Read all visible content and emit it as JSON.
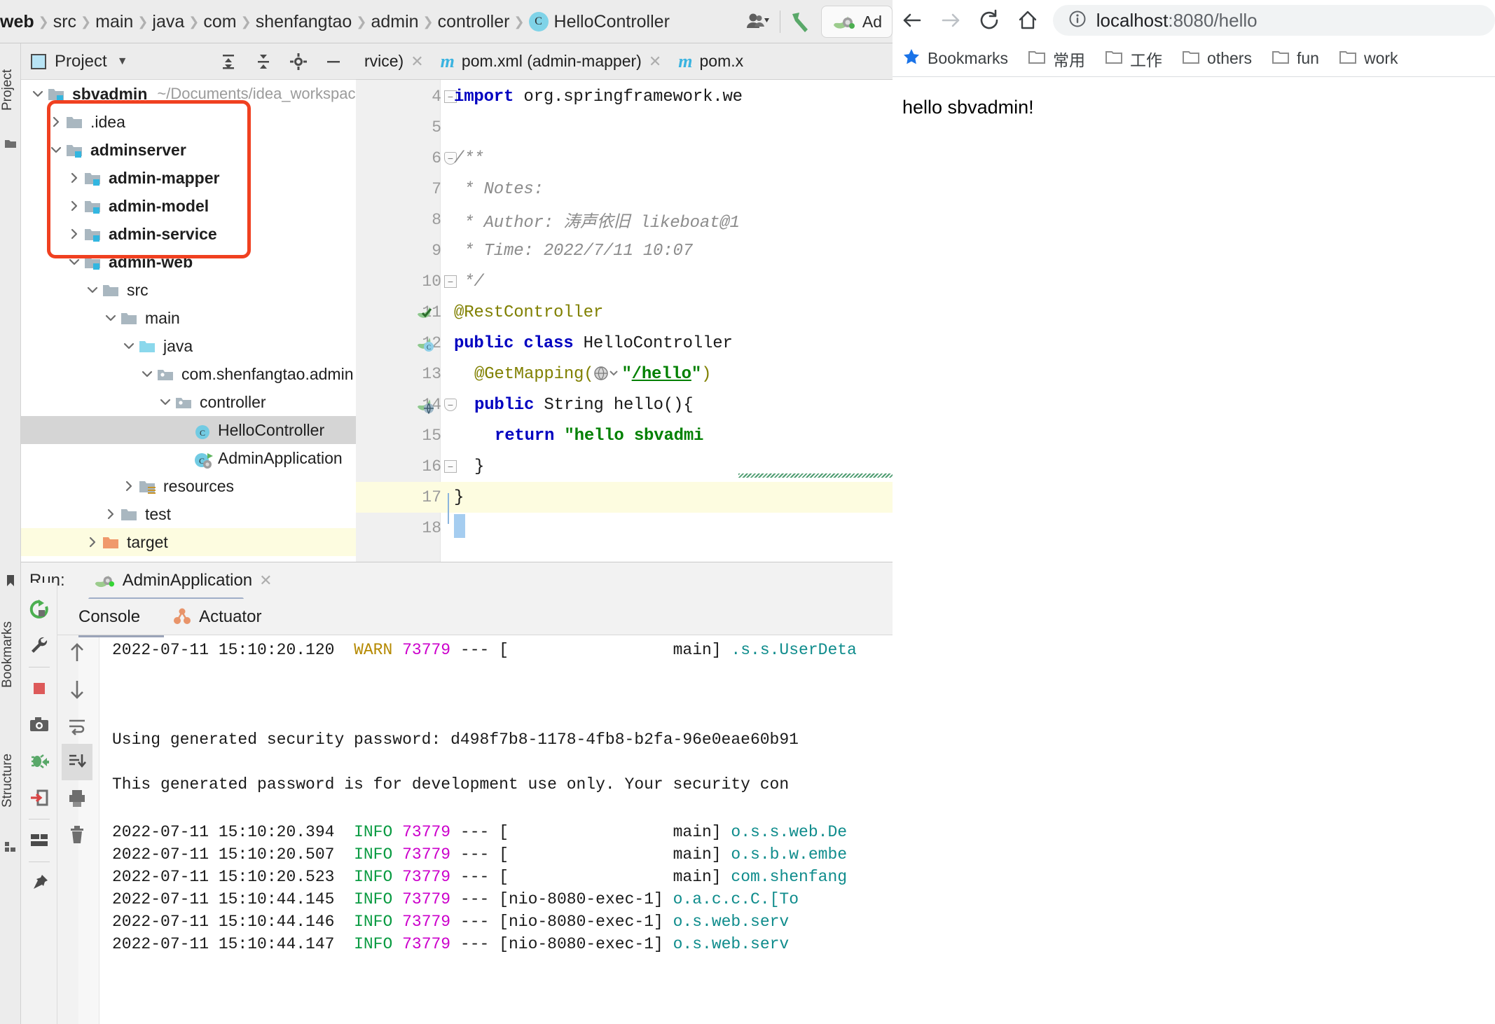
{
  "ide": {
    "breadcrumb": [
      {
        "label": "web",
        "type": "module"
      },
      {
        "label": "src",
        "type": "dir"
      },
      {
        "label": "main",
        "type": "dir"
      },
      {
        "label": "java",
        "type": "dir"
      },
      {
        "label": "com",
        "type": "dir"
      },
      {
        "label": "shenfangtao",
        "type": "dir"
      },
      {
        "label": "admin",
        "type": "dir"
      },
      {
        "label": "controller",
        "type": "dir"
      },
      {
        "label": "HelloController",
        "type": "class"
      }
    ],
    "class_badge": "C",
    "toolbar": {
      "profile_icon": "user-dropdown-icon",
      "build_icon": "hammer-icon",
      "run_config_label": "Ad"
    },
    "project_panel": {
      "title": "Project",
      "icon": "project-window-icon",
      "actions": [
        "expand-all-icon",
        "collapse-all-icon",
        "settings-gear-icon",
        "hide-minus-icon"
      ]
    },
    "tool_stripes": {
      "left_top": "Project",
      "left_bottom_1": "Bookmarks",
      "left_bottom_2": "Structure"
    },
    "tree": [
      {
        "label": "sbvadmin",
        "path": "~/Documents/idea_workspace/sbv",
        "indent": 0,
        "state": "open",
        "icon": "module-folder",
        "bold": true,
        "selected": false
      },
      {
        "label": ".idea",
        "path": "",
        "indent": 1,
        "state": "closed",
        "icon": "folder",
        "bold": false,
        "selected": false
      },
      {
        "label": "adminserver",
        "path": "",
        "indent": 1,
        "state": "open",
        "icon": "module-folder",
        "bold": true,
        "selected": false
      },
      {
        "label": "admin-mapper",
        "path": "",
        "indent": 2,
        "state": "closed",
        "icon": "module-folder",
        "bold": true,
        "selected": false
      },
      {
        "label": "admin-model",
        "path": "",
        "indent": 2,
        "state": "closed",
        "icon": "module-folder",
        "bold": true,
        "selected": false
      },
      {
        "label": "admin-service",
        "path": "",
        "indent": 2,
        "state": "closed",
        "icon": "module-folder",
        "bold": true,
        "selected": false
      },
      {
        "label": "admin-web",
        "path": "",
        "indent": 2,
        "state": "open",
        "icon": "module-folder",
        "bold": true,
        "selected": false
      },
      {
        "label": "src",
        "path": "",
        "indent": 3,
        "state": "open",
        "icon": "folder",
        "bold": false,
        "selected": false
      },
      {
        "label": "main",
        "path": "",
        "indent": 4,
        "state": "open",
        "icon": "folder",
        "bold": false,
        "selected": false
      },
      {
        "label": "java",
        "path": "",
        "indent": 5,
        "state": "open",
        "icon": "source-folder",
        "bold": false,
        "selected": false
      },
      {
        "label": "com.shenfangtao.admin",
        "path": "",
        "indent": 6,
        "state": "open",
        "icon": "package",
        "bold": false,
        "selected": false
      },
      {
        "label": "controller",
        "path": "",
        "indent": 7,
        "state": "open",
        "icon": "package",
        "bold": false,
        "selected": false
      },
      {
        "label": "HelloController",
        "path": "",
        "indent": 8,
        "state": "leaf",
        "icon": "java-class",
        "bold": false,
        "selected": true
      },
      {
        "label": "AdminApplication",
        "path": "",
        "indent": 8,
        "state": "leaf",
        "icon": "spring-class",
        "bold": false,
        "selected": false
      },
      {
        "label": "resources",
        "path": "",
        "indent": 5,
        "state": "closed",
        "icon": "resource-folder",
        "bold": false,
        "selected": false
      },
      {
        "label": "test",
        "path": "",
        "indent": 4,
        "state": "closed",
        "icon": "folder",
        "bold": false,
        "selected": false
      },
      {
        "label": "target",
        "path": "",
        "indent": 3,
        "state": "closed",
        "icon": "target-folder",
        "bold": false,
        "selected": false,
        "highlight": true
      }
    ],
    "annotation": {
      "shape": "rounded-rect",
      "color": "#f04020"
    },
    "editor_tabs": [
      {
        "label": "rvice)",
        "icon": "maven-m",
        "closable": true,
        "show_icon": false
      },
      {
        "label": "pom.xml (admin-mapper)",
        "icon": "maven-m",
        "closable": true,
        "show_icon": true
      },
      {
        "label": "pom.x",
        "icon": "maven-m",
        "closable": false,
        "show_icon": true
      }
    ],
    "code": [
      {
        "n": "4",
        "indent": 0,
        "tokens": [
          {
            "t": "import ",
            "c": "kw"
          },
          {
            "t": "org.springframework.we",
            "c": "plain"
          }
        ],
        "fold": "minus",
        "gutter": ""
      },
      {
        "n": "5",
        "indent": 0,
        "tokens": [],
        "fold": "",
        "gutter": ""
      },
      {
        "n": "6",
        "indent": 0,
        "tokens": [
          {
            "t": "/**",
            "c": "cmt"
          }
        ],
        "fold": "minus-round",
        "gutter": ""
      },
      {
        "n": "7",
        "indent": 0,
        "tokens": [
          {
            "t": " * Notes:",
            "c": "cmt"
          }
        ],
        "fold": "",
        "gutter": ""
      },
      {
        "n": "8",
        "indent": 0,
        "tokens": [
          {
            "t": " * Author: 涛声依旧 likeboat@1",
            "c": "cmt"
          }
        ],
        "fold": "",
        "gutter": ""
      },
      {
        "n": "9",
        "indent": 0,
        "tokens": [
          {
            "t": " * Time: 2022/7/11 10:07",
            "c": "cmt"
          }
        ],
        "fold": "",
        "gutter": ""
      },
      {
        "n": "10",
        "indent": 0,
        "tokens": [
          {
            "t": " */",
            "c": "cmt"
          }
        ],
        "fold": "minus",
        "gutter": ""
      },
      {
        "n": "11",
        "indent": 0,
        "tokens": [
          {
            "t": "@RestController",
            "c": "ann"
          }
        ],
        "fold": "",
        "gutter": "spring-bean-check-icon"
      },
      {
        "n": "12",
        "indent": 0,
        "tokens": [
          {
            "t": "public class ",
            "c": "kw"
          },
          {
            "t": "HelloController ",
            "c": "plain"
          }
        ],
        "fold": "",
        "gutter": "spring-bean-icon"
      },
      {
        "n": "13",
        "indent": 1,
        "tokens": [
          {
            "t": "@GetMapping(",
            "c": "ann"
          },
          {
            "t": "GLOBE",
            "c": "globe"
          },
          {
            "t": "\"",
            "c": "str"
          },
          {
            "t": "/hello",
            "c": "ulink"
          },
          {
            "t": "\"",
            "c": "str"
          },
          {
            "t": ")",
            "c": "ann"
          }
        ],
        "fold": "",
        "gutter": ""
      },
      {
        "n": "14",
        "indent": 1,
        "tokens": [
          {
            "t": "public ",
            "c": "kw"
          },
          {
            "t": "String hello(){",
            "c": "plain"
          }
        ],
        "fold": "minus-round",
        "gutter": "spring-mapping-icon"
      },
      {
        "n": "15",
        "indent": 2,
        "tokens": [
          {
            "t": "return ",
            "c": "kw"
          },
          {
            "t": "\"hello sbvadmi",
            "c": "str"
          }
        ],
        "fold": "",
        "gutter": ""
      },
      {
        "n": "16",
        "indent": 1,
        "tokens": [
          {
            "t": "}",
            "c": "plain"
          }
        ],
        "fold": "minus",
        "gutter": ""
      },
      {
        "n": "17",
        "indent": 0,
        "tokens": [
          {
            "t": "}",
            "c": "plain"
          }
        ],
        "fold": "",
        "gutter": "",
        "current": true
      },
      {
        "n": "18",
        "indent": 0,
        "tokens": [],
        "fold": "",
        "gutter": ""
      }
    ],
    "run_window": {
      "run_label": "Run:",
      "config_name": "AdminApplication",
      "config_icon": "spring-boot-icon",
      "close_icon": "close-icon",
      "tabs": [
        {
          "label": "Console",
          "icon": ""
        },
        {
          "label": "Actuator",
          "icon": "actuator-icon"
        }
      ],
      "side_tools": [
        "rerun-icon",
        "wrench-icon",
        "stop-icon",
        "camera-icon",
        "thread-dump-icon",
        "exit-icon",
        "layout-icon",
        "pin-icon"
      ],
      "console_tools": [
        "scroll-up-icon",
        "scroll-down-icon",
        "soft-wrap-icon",
        "scroll-to-end-icon",
        "print-icon",
        "trash-icon"
      ],
      "log_lines": [
        {
          "time": "2022-07-11 15:10:20.120",
          "level": "WARN",
          "pid": "73779",
          "dashes": "---",
          "thread": "[                 main]",
          "logger": ".s.s.UserDeta",
          "message": ""
        },
        {
          "time": "",
          "level": "",
          "pid": "",
          "dashes": "",
          "thread": "",
          "logger": "",
          "message": "Using generated security password: d498f7b8-1178-4fb8-b2fa-96e0eae60b91"
        },
        {
          "time": "",
          "level": "",
          "pid": "",
          "dashes": "",
          "thread": "",
          "logger": "",
          "message": "This generated password is for development use only. Your security con"
        },
        {
          "time": "2022-07-11 15:10:20.394",
          "level": "INFO",
          "pid": "73779",
          "dashes": "---",
          "thread": "[                 main]",
          "logger": "o.s.s.web.De",
          "message": ""
        },
        {
          "time": "2022-07-11 15:10:20.507",
          "level": "INFO",
          "pid": "73779",
          "dashes": "---",
          "thread": "[                 main]",
          "logger": "o.s.b.w.embe",
          "message": ""
        },
        {
          "time": "2022-07-11 15:10:20.523",
          "level": "INFO",
          "pid": "73779",
          "dashes": "---",
          "thread": "[                 main]",
          "logger": "com.shenfang",
          "message": ""
        },
        {
          "time": "2022-07-11 15:10:44.145",
          "level": "INFO",
          "pid": "73779",
          "dashes": "---",
          "thread": "[nio-8080-exec-1]",
          "logger": "o.a.c.c.C.[To",
          "message": ""
        },
        {
          "time": "2022-07-11 15:10:44.146",
          "level": "INFO",
          "pid": "73779",
          "dashes": "---",
          "thread": "[nio-8080-exec-1]",
          "logger": "o.s.web.serv",
          "message": ""
        },
        {
          "time": "2022-07-11 15:10:44.147",
          "level": "INFO",
          "pid": "73779",
          "dashes": "---",
          "thread": "[nio-8080-exec-1]",
          "logger": "o.s.web.serv",
          "message": ""
        }
      ]
    }
  },
  "browser": {
    "nav": {
      "back": "back-arrow-icon",
      "forward": "forward-arrow-icon",
      "reload": "reload-icon",
      "home": "home-icon"
    },
    "omnibox": {
      "info_icon": "info-circle-icon",
      "host": "localhost",
      "rest": ":8080/hello",
      "full_url": "localhost:8080/hello"
    },
    "bookmarks": [
      {
        "label": "Bookmarks",
        "icon": "star-icon"
      },
      {
        "label": "常用",
        "icon": "folder-icon"
      },
      {
        "label": "工作",
        "icon": "folder-icon"
      },
      {
        "label": "others",
        "icon": "folder-icon"
      },
      {
        "label": "fun",
        "icon": "folder-icon"
      },
      {
        "label": "work",
        "icon": "folder-icon"
      }
    ],
    "page_body": "hello sbvadmin!"
  },
  "colors": {
    "accent_blue": "#7fd3e8",
    "annotation_red": "#f04020",
    "selection_gray": "#d5d5d5",
    "current_line": "#fdfce0",
    "link_blue": "#1a73e8",
    "info_green": "#0a9b42",
    "warn_amber": "#b58900",
    "pid_magenta": "#cc00cc",
    "logger_teal": "#0f8c8c"
  }
}
